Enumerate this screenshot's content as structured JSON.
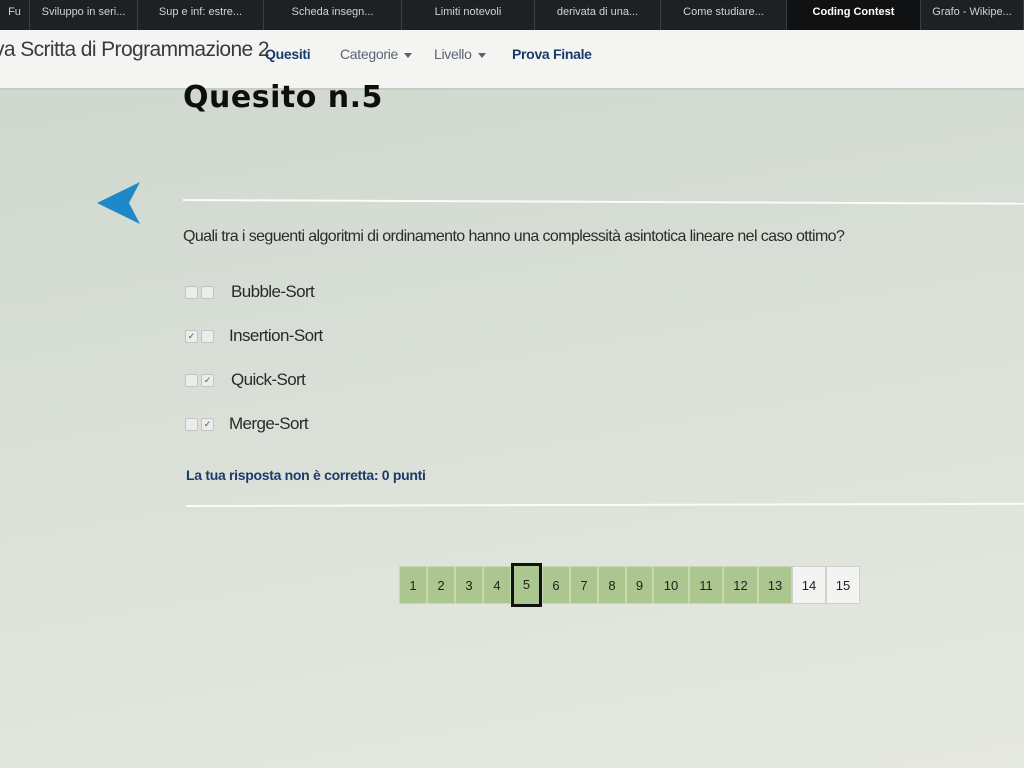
{
  "browser": {
    "tabs": [
      {
        "label": "Fu",
        "width": 30
      },
      {
        "label": "Sviluppo in seri...",
        "width": 108
      },
      {
        "label": "Sup e inf: estre...",
        "width": 126
      },
      {
        "label": "Scheda insegn...",
        "width": 138
      },
      {
        "label": "Limiti notevoli",
        "width": 133
      },
      {
        "label": "derivata di una...",
        "width": 126
      },
      {
        "label": "Come studiare...",
        "width": 126
      },
      {
        "label": "Coding Contest",
        "width": 134,
        "active": true
      },
      {
        "label": "Grafo - Wikipe...",
        "width": 103
      }
    ]
  },
  "navbar": {
    "site_title": "va Scritta di Programmazione 2",
    "quesiti": "Quesiti",
    "categorie": "Categorie",
    "livello": "Livello",
    "prova_finale": "Prova Finale"
  },
  "page": {
    "heading": "Quesito n.5",
    "question": "Quali tra i seguenti algoritmi di ordinamento hanno una complessità asintotica lineare nel caso ottimo?",
    "options": [
      {
        "label": "Bubble-Sort",
        "left_checked": false,
        "right_checked": false
      },
      {
        "label": "Insertion-Sort",
        "left_checked": true,
        "right_checked": false
      },
      {
        "label": "Quick-Sort",
        "left_checked": false,
        "right_checked": true
      },
      {
        "label": "Merge-Sort",
        "left_checked": false,
        "right_checked": true
      }
    ],
    "feedback": "La tua risposta non è corretta: 0 punti"
  },
  "pagination": {
    "current": 5,
    "pages": [
      {
        "label": "1",
        "visited": true
      },
      {
        "label": "2",
        "visited": true
      },
      {
        "label": "3",
        "visited": true
      },
      {
        "label": "4",
        "visited": true
      },
      {
        "label": "5",
        "visited": true
      },
      {
        "label": "6",
        "visited": true
      },
      {
        "label": "7",
        "visited": true
      },
      {
        "label": "8",
        "visited": true
      },
      {
        "label": "9",
        "visited": true
      },
      {
        "label": "10",
        "visited": true
      },
      {
        "label": "11",
        "visited": true
      },
      {
        "label": "12",
        "visited": true
      },
      {
        "label": "13",
        "visited": true
      },
      {
        "label": "14",
        "visited": false
      },
      {
        "label": "15",
        "visited": false
      }
    ]
  },
  "colors": {
    "visited_page": "#acc690",
    "unvisited_page": "#f3f4f2",
    "back_arrow": "#1e88c8",
    "link_blue": "#1a3a6b"
  }
}
